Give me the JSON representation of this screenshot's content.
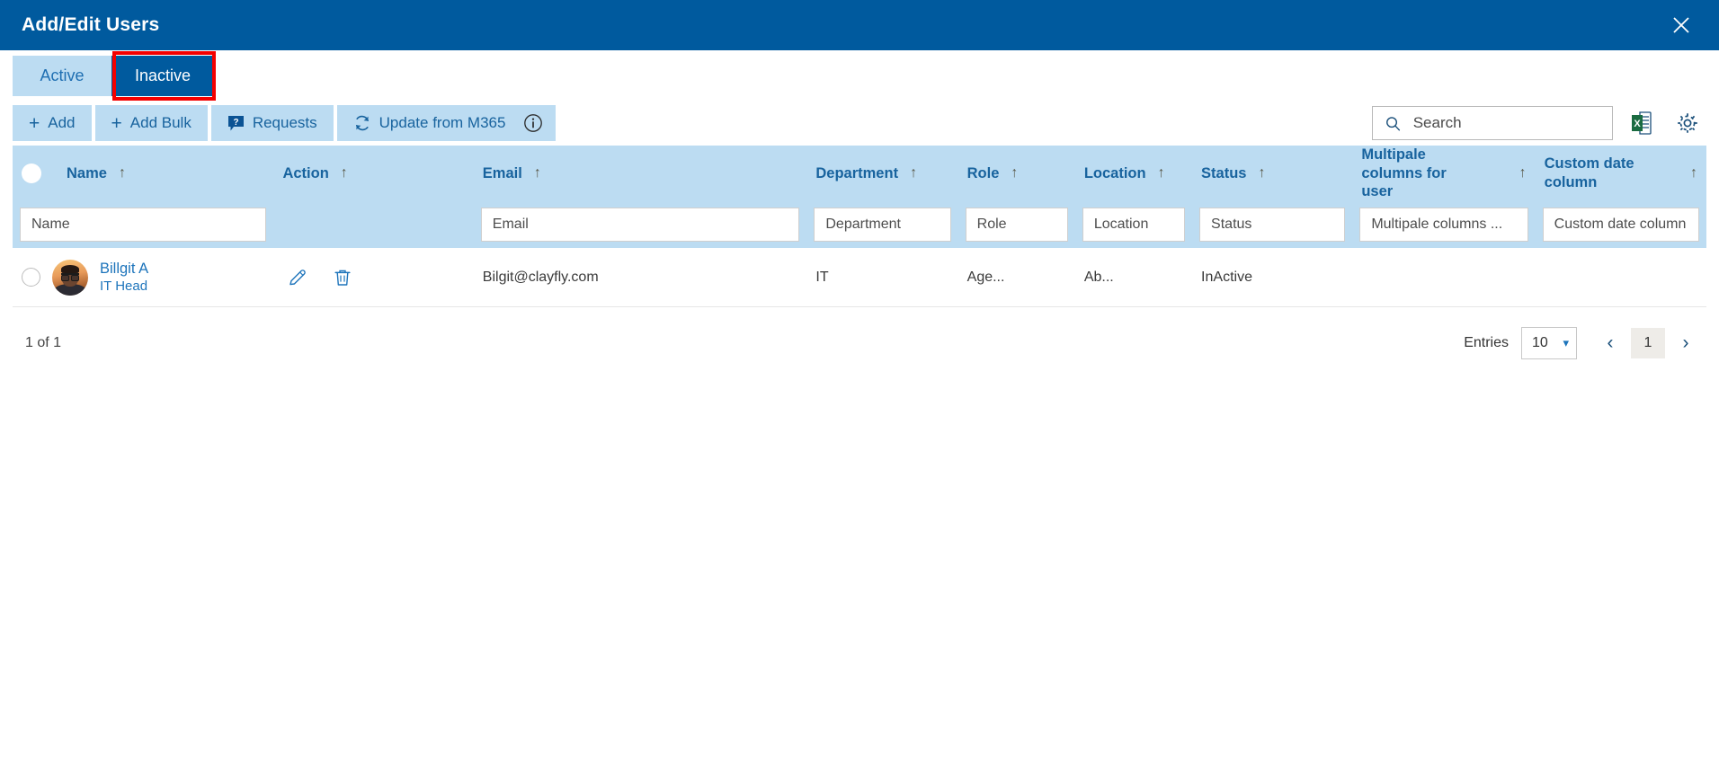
{
  "window": {
    "title": "Add/Edit Users",
    "close_label": "×"
  },
  "tabs": [
    {
      "label": "Active",
      "selected": false
    },
    {
      "label": "Inactive",
      "selected": true
    }
  ],
  "toolbar": {
    "add_label": "Add",
    "add_bulk_label": "Add Bulk",
    "requests_label": "Requests",
    "update_m365_label": "Update from M365",
    "plus_glyph": "+",
    "info_icon": "info-circle-icon",
    "requests_icon": "question-bubble-icon",
    "refresh_icon": "sync-icon",
    "search_placeholder": "Search",
    "search_value": "",
    "search_icon": "search-icon",
    "excel_icon": "excel-export-icon",
    "settings_icon": "gear-icon"
  },
  "table": {
    "sort_arrow": "↑",
    "columns": [
      {
        "label": "Name",
        "filter_placeholder": "Name"
      },
      {
        "label": "Action",
        "filter_placeholder": ""
      },
      {
        "label": "Email",
        "filter_placeholder": "Email"
      },
      {
        "label": "Department",
        "filter_placeholder": "Department"
      },
      {
        "label": "Role",
        "filter_placeholder": "Role"
      },
      {
        "label": "Location",
        "filter_placeholder": "Location"
      },
      {
        "label": "Status",
        "filter_placeholder": "Status"
      },
      {
        "label": "Multipale columns for user",
        "filter_placeholder": "Multipale columns ..."
      },
      {
        "label": "Custom date column",
        "filter_placeholder": "Custom date column"
      }
    ],
    "rows": [
      {
        "name": "Billgit A",
        "title": "IT Head",
        "email": "Bilgit@clayfly.com",
        "department": "IT",
        "role": "Age...",
        "location": "Ab...",
        "status": "InActive",
        "multiple_columns": "",
        "custom_date": "",
        "edit_icon": "pencil-icon",
        "delete_icon": "trash-icon"
      }
    ]
  },
  "footer": {
    "count_text": "1 of 1",
    "entries_label": "Entries",
    "entries_value": "10",
    "prev_glyph": "‹",
    "next_glyph": "›",
    "current_page": "1"
  },
  "colors": {
    "brand_blue": "#005a9e",
    "light_blue": "#bcdcf2",
    "link_blue": "#1d74bb",
    "highlight_red": "#f40000"
  }
}
